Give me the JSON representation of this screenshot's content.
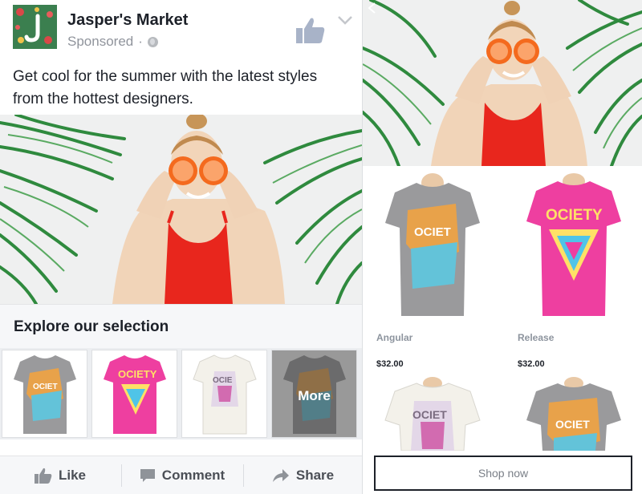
{
  "post": {
    "page_name": "Jasper's Market",
    "sponsored": "Sponsored",
    "sponsored_separator": "·",
    "text": "Get cool for the summer with the latest styles from the hottest designers.",
    "explore_title": "Explore our selection",
    "more_label": "More",
    "actions": {
      "like": "Like",
      "comment": "Comment",
      "share": "Share"
    },
    "thumbnails": [
      {
        "shirt": "grey-society",
        "color": "#9a9a9c"
      },
      {
        "shirt": "pink-society",
        "color": "#ee3fa0"
      },
      {
        "shirt": "white-society",
        "color": "#f3f1ea"
      },
      {
        "shirt": "grey-society",
        "color": "#9a9a9c"
      }
    ]
  },
  "canvas": {
    "products": [
      {
        "name": "Angular",
        "price": "$32.00",
        "color": "#9a9a9c"
      },
      {
        "name": "Release",
        "price": "$32.00",
        "color": "#ee3fa0"
      },
      {
        "name": "",
        "price": "",
        "color": "#f3f1ea"
      },
      {
        "name": "",
        "price": "",
        "color": "#9a9a9c"
      }
    ],
    "shop_now": "Shop now"
  },
  "icons": {
    "like_page": "thumbs-up-icon",
    "options": "chevron-down-icon",
    "globe": "globe-icon",
    "like": "thumbs-up-icon",
    "comment": "speech-bubble-icon",
    "share": "share-arrow-icon",
    "back": "back-arrow-icon"
  },
  "colors": {
    "text": "#1d2129",
    "secondary": "#90949c",
    "action_text": "#4b4f56",
    "like_icon": "#a8b3c8",
    "swimsuit": "#e8261d",
    "orange": "#f46a1e"
  }
}
